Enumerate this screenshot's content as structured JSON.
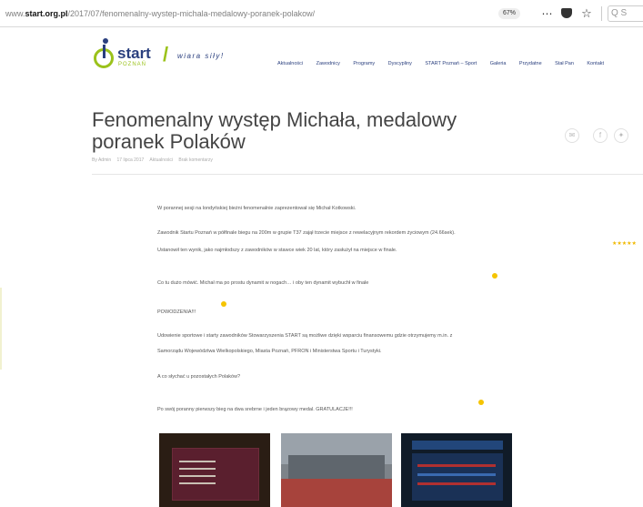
{
  "browser": {
    "url_prefix": "www.",
    "url_domain": "start.org.pl",
    "url_path": "/2017/07/fenomenalny-wystep-michala-medalowy-poranek-polakow/",
    "zoom": "67%",
    "more_icon": "ellipsis-icon",
    "pocket_icon": "pocket-icon",
    "bookmark_icon": "star-icon",
    "search_text": "Q S"
  },
  "site": {
    "logo_word": "start",
    "logo_sub": "POZNAŃ",
    "tagline": "wiara siły!",
    "nav": [
      "Aktualności",
      "Zawodnicy",
      "Programy",
      "Dyscypliny",
      "START Poznań – Sport",
      "Galeria",
      "Przydatne",
      "Stał Pan",
      "Kontakt"
    ],
    "accent_blue": "#2a3f7e",
    "accent_green": "#9bc21b"
  },
  "article": {
    "title": "Fenomenalny występ Michała, medalowy poranek Polaków",
    "meta": [
      "By Admin",
      "17 lipca 2017",
      "Aktualności",
      "Brak komentarzy"
    ],
    "share": [
      "mail-icon",
      "facebook-icon",
      "twitter-icon"
    ],
    "paragraphs": [
      "W porannej sesji na londyńskiej bieżni fenomenalnie zaprezentował się Michał Kotkowski.",
      "Zawodnik Startu Poznań w półfinale biegu na 200m w grupie T37 zajął trzecie miejsce z rewelacyjnym rekordem życiowym (24.66sek).",
      "Ustanowił ten wynik, jako najmłodszy z zawodników w stawce wiek 20 lat, który zasłużył na miejsce w finale.",
      "Co tu dużo mówić. Michał ma po prostu dynamit w nogach… i oby ten dynamit wybuchł w finale",
      "POWODZENIA!!!",
      "Udowienie sportowe i starty zawodników Stowarzyszenia START są możliwe dzięki wsparciu finansowemu gdzie otrzymujemy m.in. z",
      "Samorządu Województwa Wielkopolskiego, Miasta Poznań, PFRON i Ministerstwa Sportu i Turystyki.",
      "A co słychać u pozostałych Polaków?",
      "Po swój poranny pierwszy bieg na dwa srebrne i jeden brązowy medal. GRATULACJE!!!"
    ],
    "rating_stars": "★★★★★",
    "emoji_icon": "emoji-icon"
  }
}
